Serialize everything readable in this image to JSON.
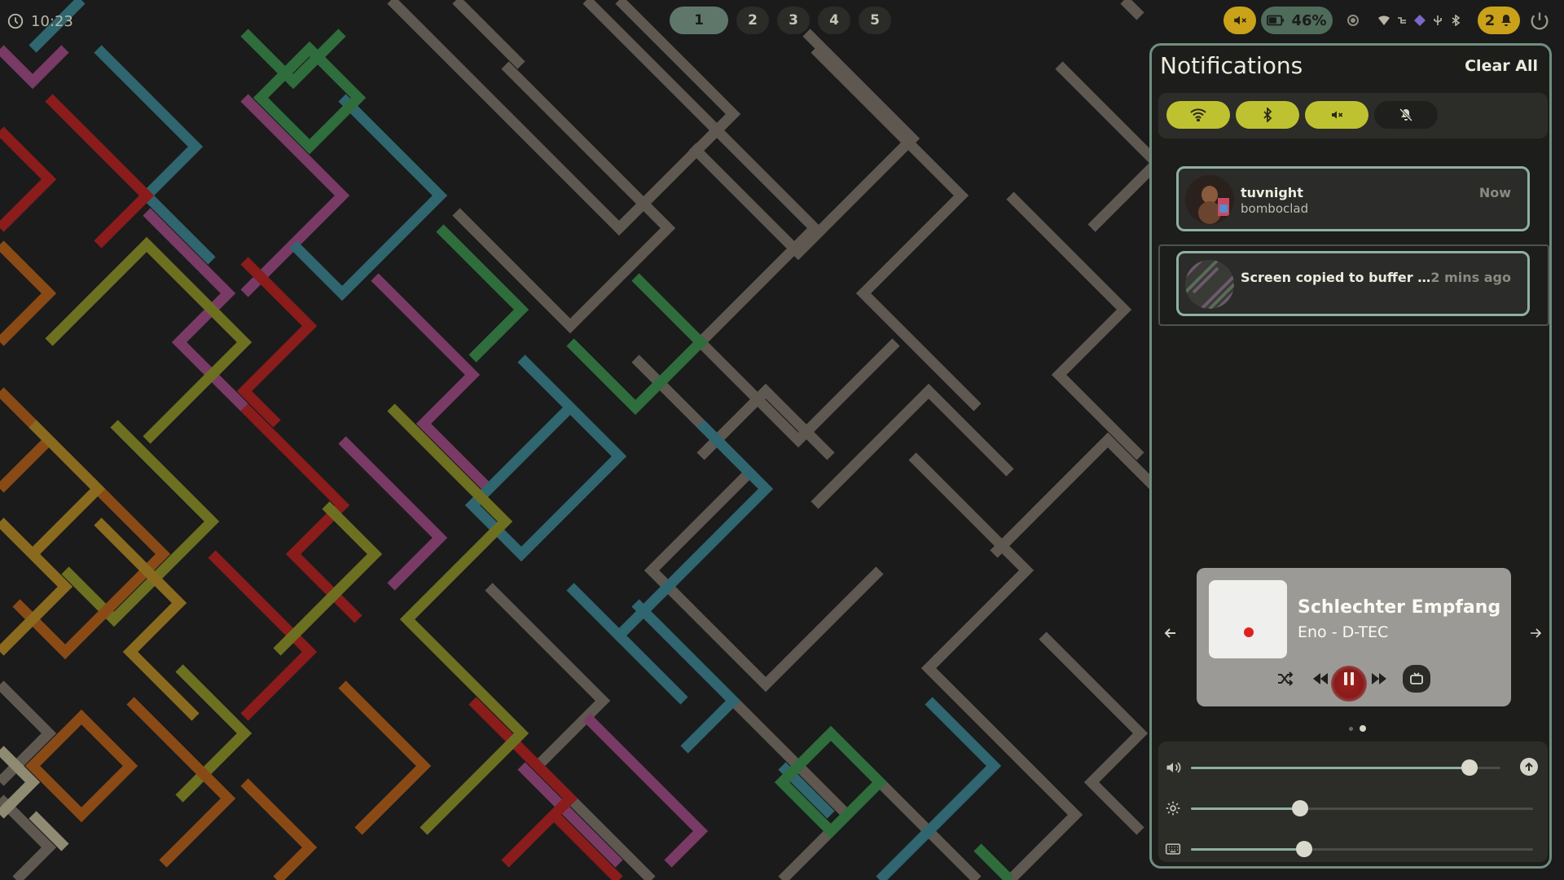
{
  "topbar": {
    "clock": "10:23",
    "workspaces": [
      "1",
      "2",
      "3",
      "4",
      "5"
    ],
    "active_workspace": "1",
    "battery": "46%",
    "notification_count": "2",
    "icons": [
      "clock-icon",
      "mute-icon",
      "battery-icon",
      "circle-icon",
      "wifi-icon",
      "tray-icon",
      "diamond-icon",
      "usb-icon",
      "bluetooth-icon",
      "bell-icon",
      "power-icon"
    ]
  },
  "panel": {
    "title": "Notifications",
    "clear_label": "Clear All",
    "quick_settings": [
      {
        "icon": "wifi-icon",
        "enabled": true
      },
      {
        "icon": "bluetooth-icon",
        "enabled": true
      },
      {
        "icon": "speaker-mute-icon",
        "enabled": true
      },
      {
        "icon": "bell-off-icon",
        "enabled": false
      }
    ],
    "notifications": [
      {
        "app": "tuvnight",
        "body": "bomboclad",
        "time": "Now"
      },
      {
        "summary": "Screen copied to buffer and ...",
        "time": "2 mins ago"
      }
    ]
  },
  "player": {
    "title": "Schlechter Empfang",
    "artist": "Eno - D-TEC",
    "page_indicator": {
      "pages": 2,
      "current": 2
    }
  },
  "sliders": {
    "volume": 0.9,
    "brightness": 0.32,
    "keyboard_backlight": 0.33
  },
  "colors": {
    "accent_yellow": "#bec230",
    "accent_green": "#5f776a",
    "warning": "#c9a21a",
    "border": "#8db1a2"
  }
}
